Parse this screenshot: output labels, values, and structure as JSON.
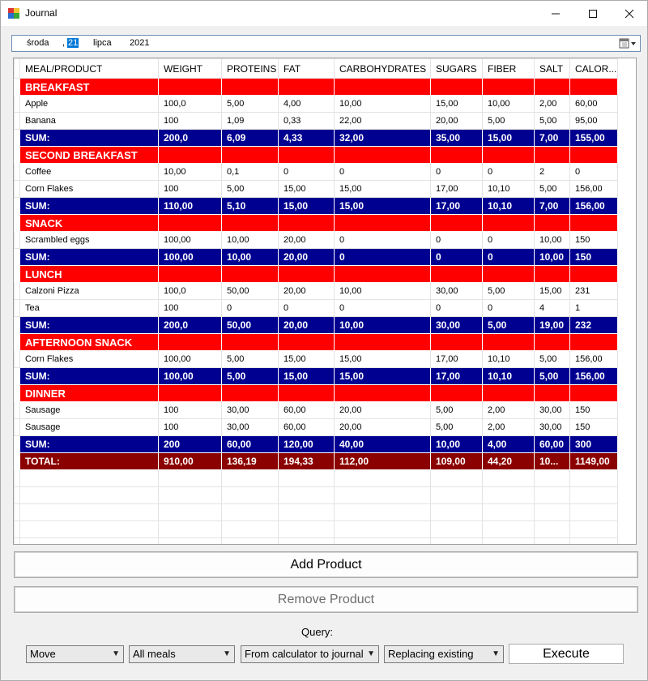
{
  "window": {
    "title": "Journal"
  },
  "date": {
    "day_name": "środa",
    "sep": ",",
    "day": "21",
    "month": "lipca",
    "year": "2021"
  },
  "columns": [
    "MEAL/PRODUCT",
    "WEIGHT",
    "PROTEINS",
    "FAT",
    "CARBOHYDRATES",
    "SUGARS",
    "FIBER",
    "SALT",
    "CALOR..."
  ],
  "rows": [
    {
      "type": "meal",
      "cells": [
        "BREAKFAST"
      ]
    },
    {
      "type": "item",
      "cells": [
        "Apple",
        "100,0",
        "5,00",
        "4,00",
        "10,00",
        "15,00",
        "10,00",
        "2,00",
        "60,00"
      ]
    },
    {
      "type": "item",
      "cells": [
        "Banana",
        "100",
        "1,09",
        "0,33",
        "22,00",
        "20,00",
        "5,00",
        "5,00",
        "95,00"
      ]
    },
    {
      "type": "sum",
      "cells": [
        "SUM:",
        "200,0",
        "6,09",
        "4,33",
        "32,00",
        "35,00",
        "15,00",
        "7,00",
        "155,00"
      ]
    },
    {
      "type": "meal",
      "cells": [
        "SECOND BREAKFAST"
      ]
    },
    {
      "type": "item",
      "cells": [
        "Coffee",
        "10,00",
        "0,1",
        "0",
        "0",
        "0",
        "0",
        "2",
        "0"
      ]
    },
    {
      "type": "item",
      "cells": [
        "Corn Flakes",
        "100",
        "5,00",
        "15,00",
        "15,00",
        "17,00",
        "10,10",
        "5,00",
        "156,00"
      ]
    },
    {
      "type": "sum",
      "cells": [
        "SUM:",
        "110,00",
        "5,10",
        "15,00",
        "15,00",
        "17,00",
        "10,10",
        "7,00",
        "156,00"
      ]
    },
    {
      "type": "meal",
      "cells": [
        "SNACK"
      ]
    },
    {
      "type": "item",
      "cells": [
        "Scrambled eggs",
        "100,00",
        "10,00",
        "20,00",
        "0",
        "0",
        "0",
        "10,00",
        "150"
      ]
    },
    {
      "type": "sum",
      "cells": [
        "SUM:",
        "100,00",
        "10,00",
        "20,00",
        "0",
        "0",
        "0",
        "10,00",
        "150"
      ]
    },
    {
      "type": "meal",
      "cells": [
        "LUNCH"
      ]
    },
    {
      "type": "item",
      "cells": [
        "Calzoni Pizza",
        "100,0",
        "50,00",
        "20,00",
        "10,00",
        "30,00",
        "5,00",
        "15,00",
        "231"
      ]
    },
    {
      "type": "item",
      "cells": [
        "Tea",
        "100",
        "0",
        "0",
        "0",
        "0",
        "0",
        "4",
        "1"
      ]
    },
    {
      "type": "sum",
      "cells": [
        "SUM:",
        "200,0",
        "50,00",
        "20,00",
        "10,00",
        "30,00",
        "5,00",
        "19,00",
        "232"
      ]
    },
    {
      "type": "meal",
      "cells": [
        "AFTERNOON SNACK"
      ]
    },
    {
      "type": "item",
      "cells": [
        "Corn Flakes",
        "100,00",
        "5,00",
        "15,00",
        "15,00",
        "17,00",
        "10,10",
        "5,00",
        "156,00"
      ]
    },
    {
      "type": "sum",
      "cells": [
        "SUM:",
        "100,00",
        "5,00",
        "15,00",
        "15,00",
        "17,00",
        "10,10",
        "5,00",
        "156,00"
      ]
    },
    {
      "type": "meal",
      "cells": [
        "DINNER"
      ]
    },
    {
      "type": "item",
      "cells": [
        "Sausage",
        "100",
        "30,00",
        "60,00",
        "20,00",
        "5,00",
        "2,00",
        "30,00",
        "150"
      ]
    },
    {
      "type": "item",
      "cells": [
        "Sausage",
        "100",
        "30,00",
        "60,00",
        "20,00",
        "5,00",
        "2,00",
        "30,00",
        "150"
      ]
    },
    {
      "type": "sum",
      "cells": [
        "SUM:",
        "200",
        "60,00",
        "120,00",
        "40,00",
        "10,00",
        "4,00",
        "60,00",
        "300"
      ]
    },
    {
      "type": "total",
      "cells": [
        "TOTAL:",
        "910,00",
        "136,19",
        "194,33",
        "112,00",
        "109,00",
        "44,20",
        "10...",
        "1149,00"
      ]
    }
  ],
  "buttons": {
    "add": "Add Product",
    "remove": "Remove Product",
    "execute": "Execute"
  },
  "query": {
    "label": "Query:",
    "action": "Move",
    "meals": "All meals",
    "direction": "From calculator to journal",
    "mode": "Replacing existing"
  },
  "colors": {
    "meal_row": "#ff0000",
    "sum_row": "#000090",
    "total_row": "#8b0000"
  },
  "icons": {
    "app": "journal-app-icon",
    "calendar": "calendar-icon",
    "minimize": "minimize-icon",
    "maximize": "maximize-icon",
    "close": "close-icon"
  }
}
